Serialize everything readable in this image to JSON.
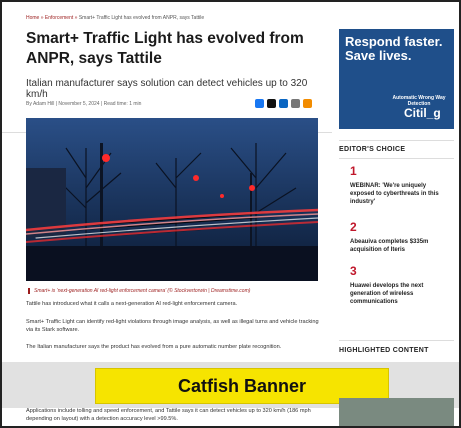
{
  "breadcrumb": {
    "items": [
      "Home",
      "Enforcement",
      "Smart+ Traffic Light has evolved from ANPR, says Tattile"
    ],
    "separator": "»"
  },
  "article": {
    "title": "Smart+ Traffic Light has evolved from ANPR, says Tattile",
    "subtitle": "Italian manufacturer says solution can detect vehicles up to 320 km/h",
    "meta": "By Adam Hill | November 5, 2024 | Read time: 1 min",
    "caption": "Smart+ is ‘next-generation AI red-light enforcement camera’ (© Stockvertorwin | Dreamstime.com)",
    "paragraphs": [
      "Tattile has introduced what it calls a next-generation AI red-light enforcement camera.",
      "Smart+ Traffic Light can identify red-light violations through image analysis, as well as illegal turns and vehicle tracking via its Stark software.",
      "The Italian manufacturer says the product has evolved from a pure automatic number plate recognition.",
      "Applications include tolling and speed enforcement, and Tattile says it can detect vehicles up to 320 km/h (186 mph depending on layout) with a detection accuracy level >99.5%."
    ],
    "share_icons": [
      "facebook-icon",
      "x-icon",
      "linkedin-icon",
      "email-icon",
      "share-icon"
    ]
  },
  "sidebar": {
    "ad": {
      "headline": "Respond faster. Save lives.",
      "tagline": "Automatic Wrong Way Detection",
      "brand": "Citil_g"
    },
    "editors_choice": {
      "title": "EDITOR'S CHOICE",
      "items": [
        {
          "num": "1",
          "text": "WEBINAR: 'We're uniquely exposed to cyberthreats in this industry'"
        },
        {
          "num": "2",
          "text": "Abeauiva completes $335m acquisition of Iteris"
        },
        {
          "num": "3",
          "text": "Huawei develops the next generation of wireless communications"
        }
      ]
    },
    "highlighted": {
      "title": "HIGHLIGHTED CONTENT"
    }
  },
  "catfish": {
    "label": "Catfish Banner"
  },
  "colors": {
    "accent": "#c0172b",
    "catfish": "#f6e400",
    "ad_bg": "#1f4f8a"
  }
}
